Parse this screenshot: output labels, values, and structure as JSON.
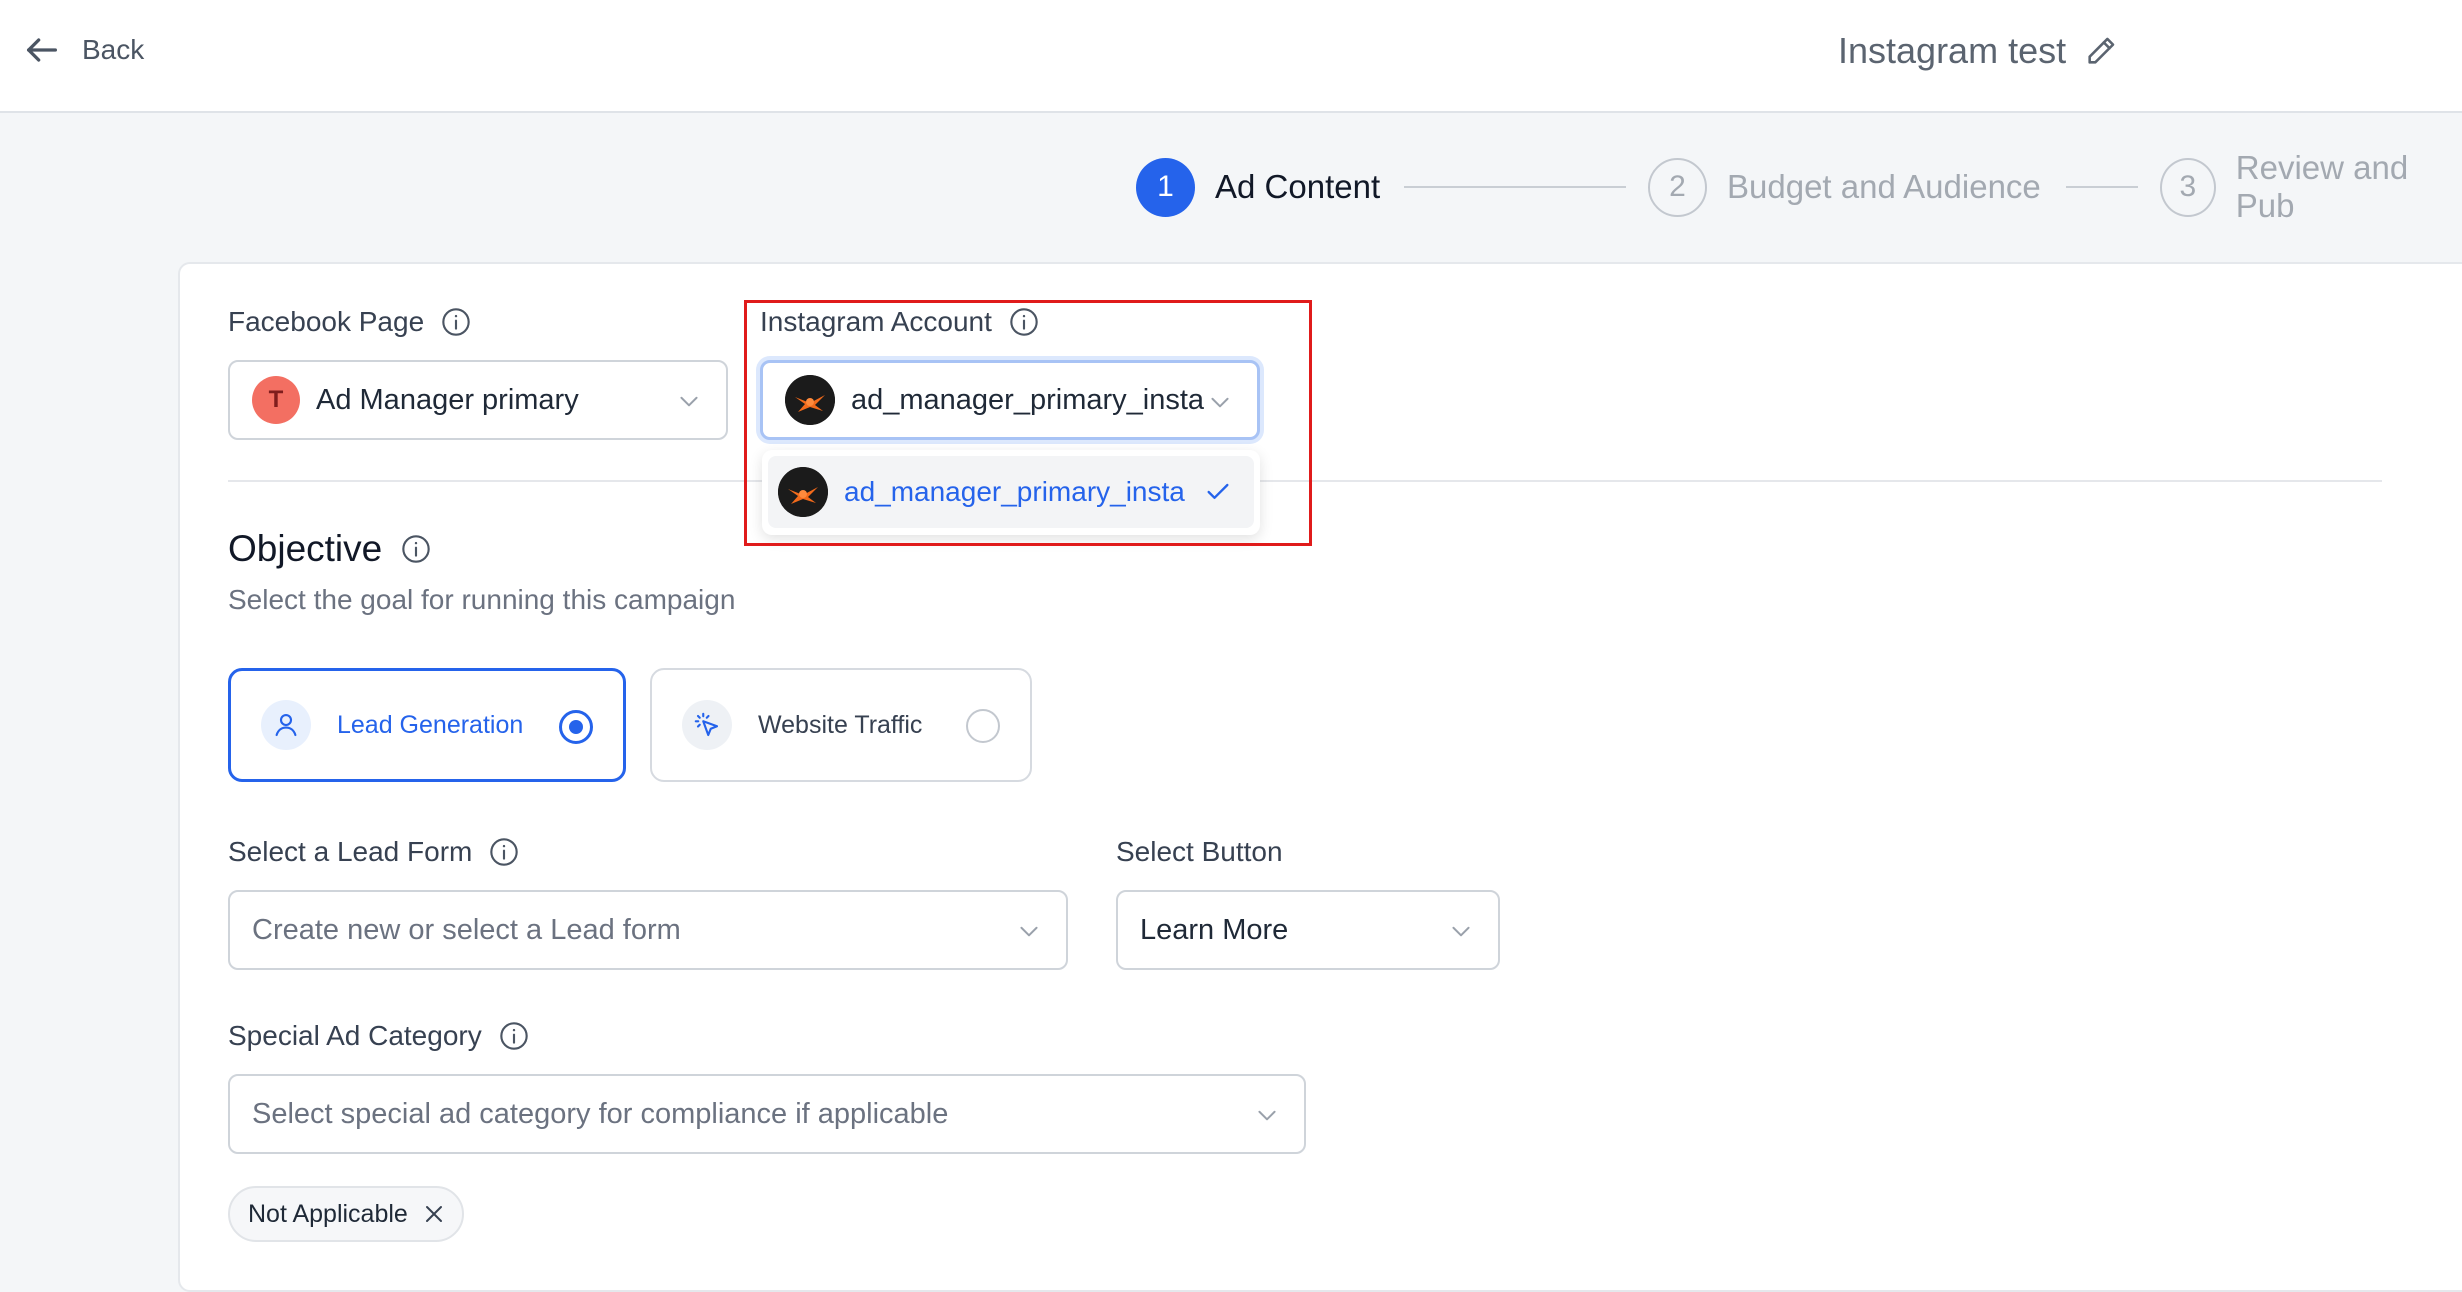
{
  "header": {
    "back_label": "Back",
    "title": "Instagram test",
    "icons": {
      "back": "arrow-left-icon",
      "edit": "pencil-icon"
    }
  },
  "stepper": {
    "steps": [
      {
        "number": "1",
        "label": "Ad Content",
        "state": "active"
      },
      {
        "number": "2",
        "label": "Budget and Audience",
        "state": "inactive"
      },
      {
        "number": "3",
        "label": "Review and Pub",
        "state": "inactive"
      }
    ]
  },
  "form": {
    "facebook_page": {
      "label": "Facebook Page",
      "avatar_letter": "T",
      "value": "Ad Manager primary"
    },
    "instagram_account": {
      "label": "Instagram Account",
      "value": "ad_manager_primary_insta",
      "options": [
        {
          "label": "ad_manager_primary_insta",
          "selected": true
        }
      ]
    },
    "objective": {
      "title": "Objective",
      "subtitle": "Select the goal for running this campaign",
      "options": [
        {
          "label": "Lead Generation",
          "icon": "user-icon",
          "selected": true
        },
        {
          "label": "Website Traffic",
          "icon": "cursor-click-icon",
          "selected": false
        }
      ]
    },
    "lead_form": {
      "label": "Select a Lead Form",
      "placeholder": "Create new or select a Lead form"
    },
    "select_button": {
      "label": "Select Button",
      "value": "Learn More"
    },
    "special_ad_category": {
      "label": "Special Ad Category",
      "placeholder": "Select special ad category for compliance if applicable",
      "tags": [
        "Not Applicable"
      ]
    }
  },
  "colors": {
    "accent": "#2563eb",
    "highlight": "#e01b1b",
    "avatar": "#f36f62"
  }
}
